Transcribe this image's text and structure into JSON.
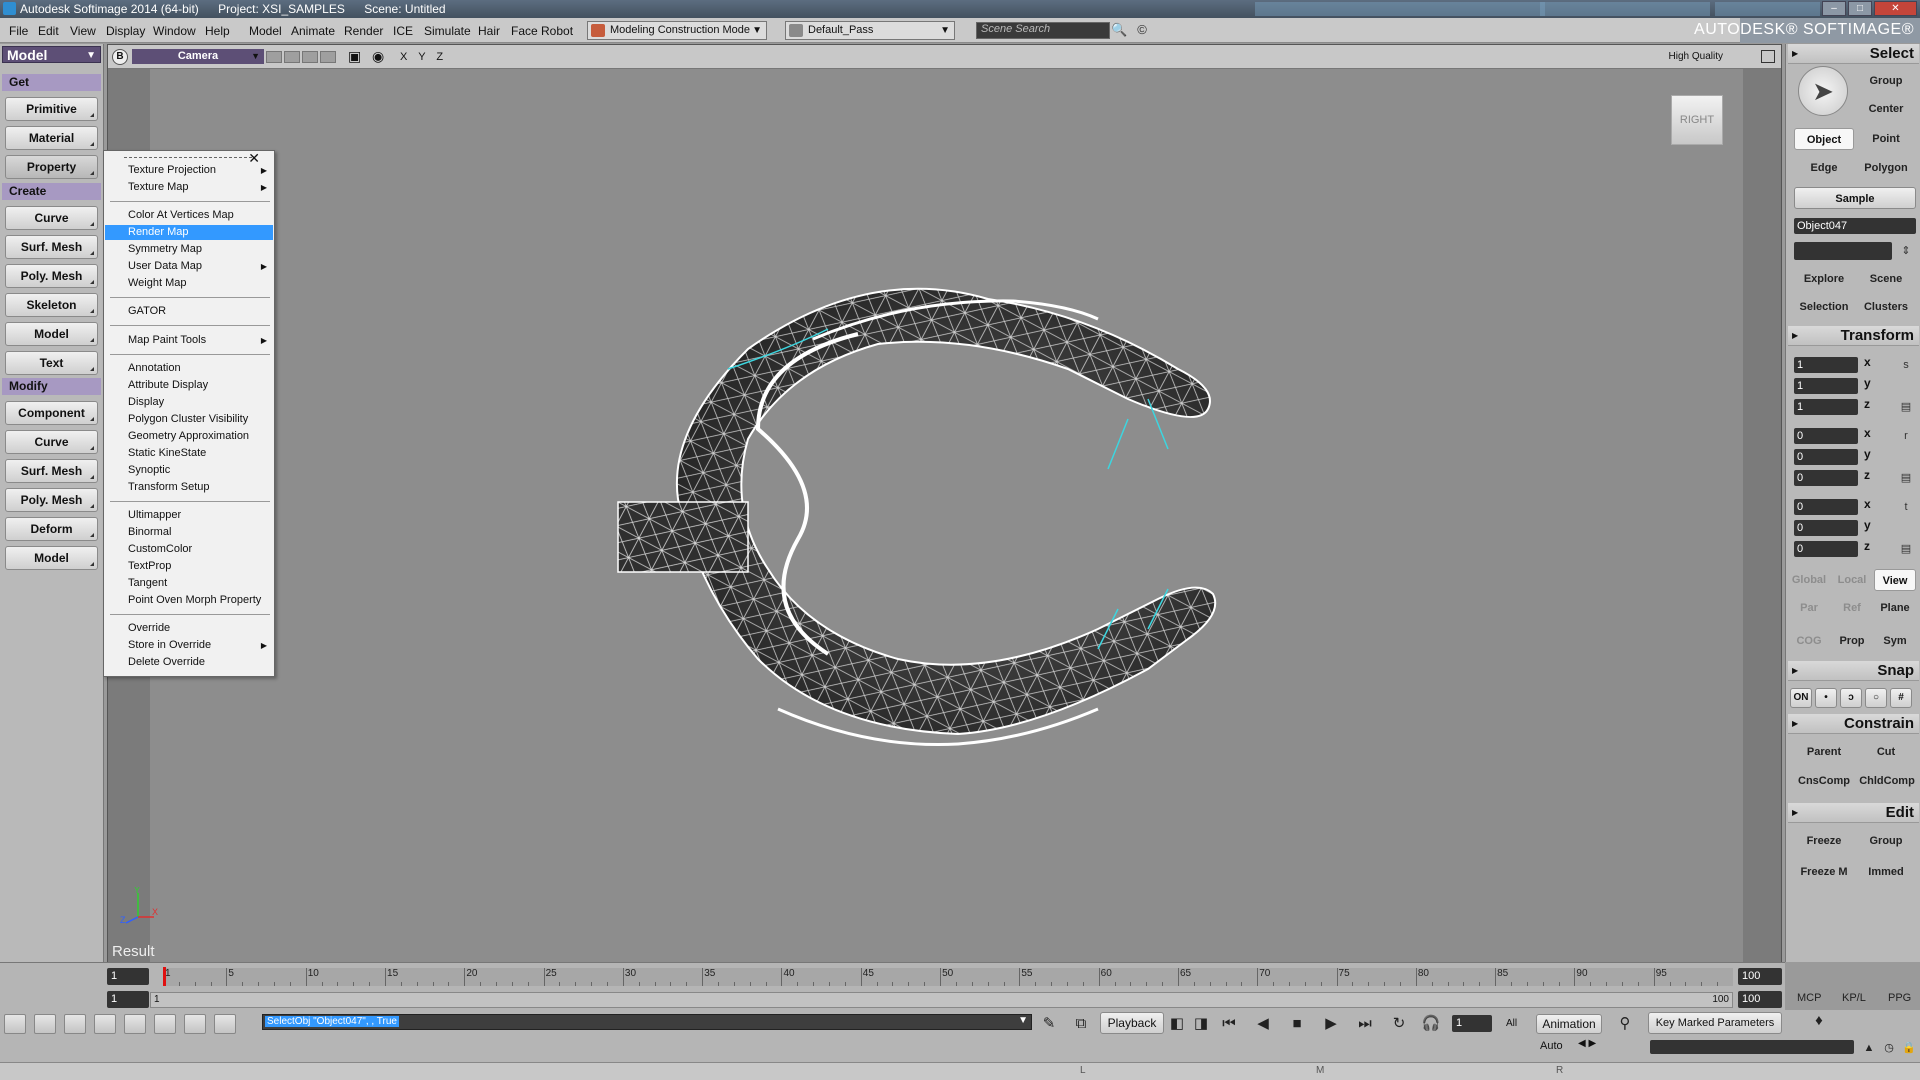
{
  "window": {
    "app_title": "Autodesk Softimage 2014 (64-bit)",
    "project": "Project: XSI_SAMPLES",
    "scene": "Scene: Untitled",
    "brand": "AUTODESK® SOFTIMAGE®",
    "controls": [
      "–",
      "□",
      "✕"
    ]
  },
  "menubar": {
    "items": [
      "File",
      "Edit",
      "View",
      "Display",
      "Window",
      "Help",
      "Model",
      "Animate",
      "Render",
      "ICE",
      "Simulate",
      "Hair",
      "Face Robot"
    ],
    "mode_dropdown": "Modeling Construction Mode",
    "pass_dropdown": "Default_Pass",
    "search_placeholder": "Scene Search"
  },
  "left_panel": {
    "mode": "Model",
    "sections": {
      "get": "Get",
      "create": "Create",
      "modify": "Modify"
    },
    "get_buttons": [
      "Primitive",
      "Material",
      "Property"
    ],
    "create_buttons": [
      "Curve",
      "Surf. Mesh",
      "Poly. Mesh",
      "Skeleton",
      "Model",
      "Text"
    ],
    "modify_buttons": [
      "Component",
      "Curve",
      "Surf. Mesh",
      "Poly. Mesh",
      "Deform",
      "Model"
    ]
  },
  "viewport": {
    "badge": "B",
    "camera": "Camera",
    "axes": "X Y Z",
    "quality": "High Quality",
    "view_cube": "RIGHT",
    "result_label": "Result"
  },
  "context_menu": {
    "group1": [
      "Texture Projection",
      "Texture Map"
    ],
    "group2": [
      "Color At Vertices Map",
      "Render Map",
      "Symmetry Map",
      "User Data Map",
      "Weight Map"
    ],
    "group3": [
      "GATOR"
    ],
    "group4": [
      "Map Paint Tools"
    ],
    "group5": [
      "Annotation",
      "Attribute Display",
      "Display",
      "Polygon Cluster Visibility",
      "Geometry Approximation",
      "Static KineState",
      "Synoptic",
      "Transform Setup"
    ],
    "group6": [
      "Ultimapper",
      "Binormal",
      "CustomColor",
      "TextProp",
      "Tangent",
      "Point Oven Morph Property"
    ],
    "group7": [
      "Override",
      "Store in Override",
      "Delete Override"
    ],
    "highlighted": "Render Map"
  },
  "right_panel": {
    "select_header": "Select",
    "group": "Group",
    "center": "Center",
    "object": "Object",
    "point": "Point",
    "edge": "Edge",
    "polygon": "Polygon",
    "sample": "Sample",
    "selected_name": "Object047",
    "explore": "Explore",
    "scene": "Scene",
    "selection": "Selection",
    "clusters": "Clusters",
    "transform_header": "Transform",
    "scale": [
      "1",
      "1",
      "1"
    ],
    "rotation": [
      "0",
      "0",
      "0"
    ],
    "translation": [
      "0",
      "0",
      "0"
    ],
    "axis_labels": [
      "x",
      "y",
      "z"
    ],
    "ref_modes": [
      "Global",
      "Local",
      "View"
    ],
    "ref_modes2": [
      "Par",
      "Ref",
      "Plane"
    ],
    "ref_modes3": [
      "COG",
      "Prop",
      "Sym"
    ],
    "snap_header": "Snap",
    "snap_on": "ON",
    "constrain_header": "Constrain",
    "parent": "Parent",
    "cut": "Cut",
    "cnscomp": "CnsComp",
    "chldcomp": "ChldComp",
    "edit_header": "Edit",
    "freeze": "Freeze",
    "edit_group": "Group",
    "freeze_m": "Freeze M",
    "immed": "Immed",
    "tabs": [
      "MCP",
      "KP/L",
      "PPG"
    ]
  },
  "timeline": {
    "ticks": [
      "1",
      "5",
      "10",
      "15",
      "20",
      "25",
      "30",
      "35",
      "40",
      "45",
      "50",
      "55",
      "60",
      "65",
      "70",
      "75",
      "80",
      "85",
      "90",
      "95"
    ],
    "current_frame": "1",
    "start_frame": "1",
    "end_frame": "100",
    "range_start": "1",
    "range_end": "100",
    "range_end_field": "100"
  },
  "bottom": {
    "command": "SelectObj \"Object047\", , True",
    "playback": "Playback",
    "frame_field": "1",
    "all": "All",
    "animation": "Animation",
    "auto": "Auto",
    "key_marked": "Key Marked Parameters",
    "mouse_buttons": [
      "L",
      "M",
      "R"
    ]
  }
}
